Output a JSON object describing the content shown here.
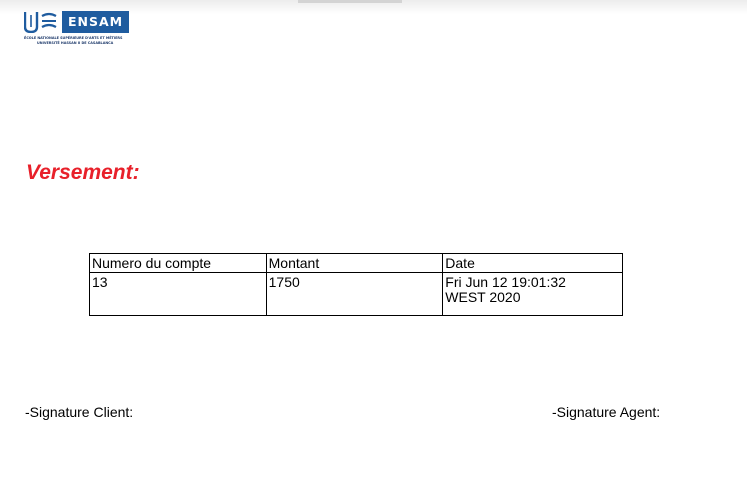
{
  "logo": {
    "text": "ENSAM",
    "line1": "ÉCOLE NATIONALE SUPÉRIEURE D'ARTS ET MÉTIERS",
    "line2": "UNIVERSITÉ HASSAN II DE CASABLANCA",
    "color": "#1f5c9f"
  },
  "heading": "Versement:",
  "heading_color": "#e8202a",
  "table": {
    "headers": [
      "Numero du compte",
      "Montant",
      "Date"
    ],
    "rows": [
      [
        "13",
        "1750",
        "Fri Jun 12 19:01:32\nWEST 2020"
      ]
    ]
  },
  "signatures": {
    "client": "-Signature Client:",
    "agent": "-Signature Agent:"
  }
}
